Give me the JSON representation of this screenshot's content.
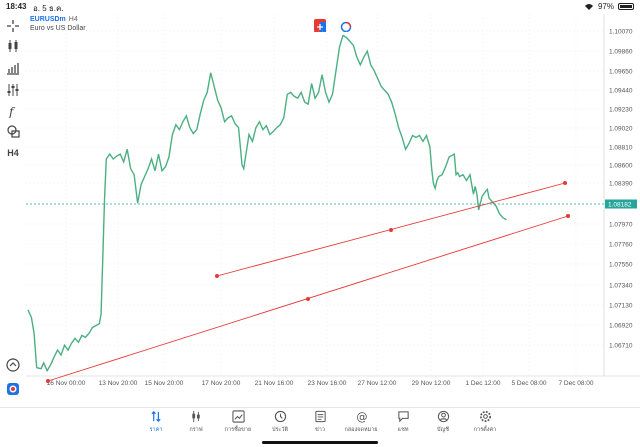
{
  "status": {
    "time": "18:43",
    "date": "อ. 5 ธ.ค.",
    "battery": "97%"
  },
  "chart": {
    "symbol": "EURUSDm",
    "timeframe": "H4",
    "description": "Euro vs US Dollar",
    "current_price": "1.08182",
    "price_labels": [
      "1.10070",
      "1.09860",
      "1.09650",
      "1.09440",
      "1.09230",
      "1.09020",
      "1.08810",
      "1.08600",
      "1.08390",
      "1.07970",
      "1.07760",
      "1.07550",
      "1.07340",
      "1.07130",
      "1.06920",
      "1.06710"
    ],
    "time_labels": [
      "16 Nov 00:00",
      "13 Nov 20:00",
      "15 Nov 20:00",
      "17 Nov 20:00",
      "21 Nov 16:00",
      "23 Nov 16:00",
      "27 Nov 12:00",
      "29 Nov 12:00",
      "1 Dec 12:00",
      "5 Dec 08:00",
      "7 Dec 08:00"
    ],
    "colors": {
      "line": "#4caf82",
      "trendline": "#e53935",
      "current_price": "#26a69a",
      "grid": "#d9d9d9",
      "accent": "#1a73e8"
    },
    "timeframe_tool": "H4"
  },
  "toolbar": {
    "icons": [
      "crosshair-icon",
      "candles-icon",
      "bar-chart-icon",
      "indicators-icon",
      "function-icon",
      "objects-icon"
    ]
  },
  "nav": [
    {
      "label": "ราคา",
      "icon": "quotes-icon",
      "active": true
    },
    {
      "label": "กราฟ",
      "icon": "chart-icon",
      "active": false
    },
    {
      "label": "การซื้อขาย",
      "icon": "trade-icon",
      "active": false
    },
    {
      "label": "ประวัติ",
      "icon": "history-icon",
      "active": false
    },
    {
      "label": "ข่าว",
      "icon": "news-icon",
      "active": false
    },
    {
      "label": "กล่องจดหมาย",
      "icon": "mailbox-icon",
      "active": false
    },
    {
      "label": "แชท",
      "icon": "chat-icon",
      "active": false
    },
    {
      "label": "บัญชี",
      "icon": "account-icon",
      "active": false
    },
    {
      "label": "การตั้งค่า",
      "icon": "settings-icon",
      "active": false
    }
  ]
}
